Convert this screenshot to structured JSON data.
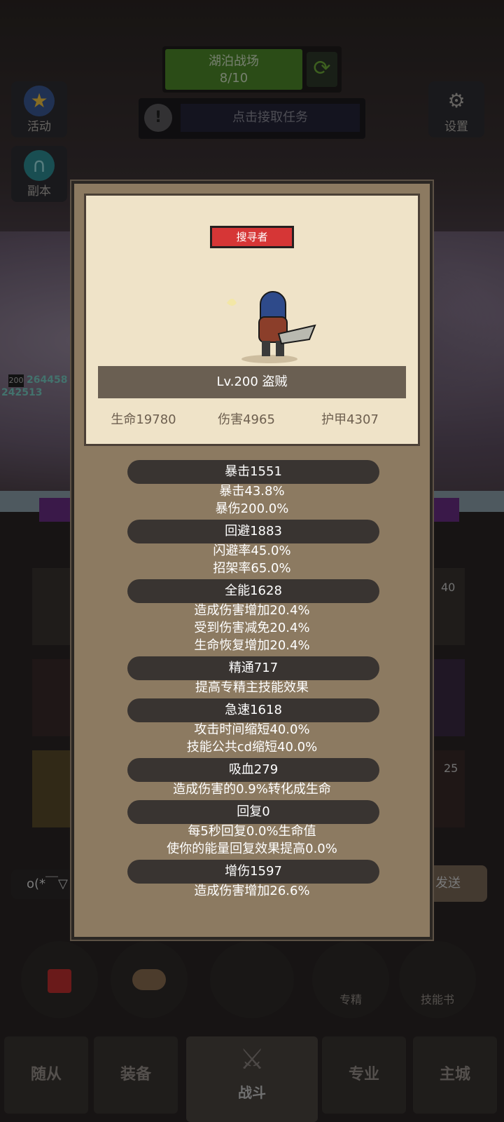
{
  "hud": {
    "map_name": "湖泊战场",
    "map_progress": "8/10",
    "task_text": "点击接取任务",
    "activity_label": "活动",
    "dungeon_label": "副本",
    "settings_label": "设置"
  },
  "battle": {
    "hp_level": "200",
    "hp_value_1": "264458",
    "hp_value_2": "242513",
    "chat_text": "o(*￣▽",
    "send_label": "发送",
    "slot_level_1": "40",
    "slot_level_2": "25"
  },
  "bottom_buttons": {
    "mastery_label": "专精",
    "skillbook_label": "技能书"
  },
  "nav": {
    "followers": "随从",
    "equipment": "装备",
    "battle": "战斗",
    "profession": "专业",
    "main_city": "主城"
  },
  "hero": {
    "title_badge": "搜寻者",
    "level_class": "Lv.200 盗贼",
    "base_stats": [
      {
        "label": "生命19780"
      },
      {
        "label": "伤害4965"
      },
      {
        "label": "护甲4307"
      }
    ]
  },
  "stats": [
    {
      "header": "暴击1551",
      "lines": [
        "暴击43.8%",
        "暴伤200.0%"
      ]
    },
    {
      "header": "回避1883",
      "lines": [
        "闪避率45.0%",
        "招架率65.0%"
      ]
    },
    {
      "header": "全能1628",
      "lines": [
        "造成伤害增加20.4%",
        "受到伤害减免20.4%",
        "生命恢复增加20.4%"
      ]
    },
    {
      "header": "精通717",
      "lines": [
        "提高专精主技能效果"
      ]
    },
    {
      "header": "急速1618",
      "lines": [
        "攻击时间缩短40.0%",
        "技能公共cd缩短40.0%"
      ]
    },
    {
      "header": "吸血279",
      "lines": [
        "造成伤害的0.9%转化成生命"
      ]
    },
    {
      "header": "回复0",
      "lines": [
        "每5秒回复0.0%生命值",
        "使你的能量回复效果提高0.0%"
      ]
    },
    {
      "header": "增伤1597",
      "lines": [
        "造成伤害增加26.6%"
      ]
    }
  ],
  "colors": {
    "modal_bg": "#8c7a61",
    "portrait_bg": "#efe3c8",
    "badge_red": "#d63636",
    "pill_dark": "#393431"
  }
}
